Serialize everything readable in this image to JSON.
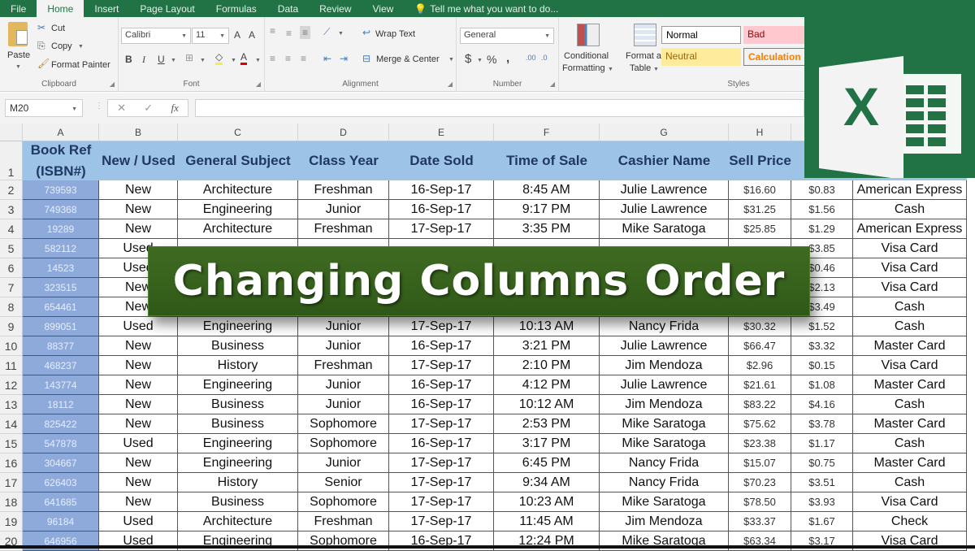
{
  "ribbon_tabs": [
    "File",
    "Home",
    "Insert",
    "Page Layout",
    "Formulas",
    "Data",
    "Review",
    "View"
  ],
  "tell_me": "Tell me what you want to do...",
  "clipboard": {
    "paste": "Paste",
    "cut": "Cut",
    "copy": "Copy",
    "format_painter": "Format Painter",
    "label": "Clipboard"
  },
  "font": {
    "name": "Calibri",
    "size": "11",
    "label": "Font",
    "bold": "B",
    "italic": "I",
    "underline": "U"
  },
  "alignment": {
    "wrap_text": "Wrap Text",
    "merge_center": "Merge & Center",
    "label": "Alignment"
  },
  "number": {
    "format": "General",
    "currency": "$",
    "percent": "%",
    "comma": ",",
    "label": "Number"
  },
  "styles": {
    "conditional": "Conditional",
    "formatting": "Formatting",
    "format_as": "Format as",
    "table": "Table",
    "normal": "Normal",
    "bad": "Bad",
    "neutral": "Neutral",
    "calculation": "Calculation",
    "label": "Styles"
  },
  "formula_bar": {
    "name_box": "M20",
    "value": ""
  },
  "banner": "Changing Columns Order",
  "logo_letter": "X",
  "columns": [
    "A",
    "B",
    "C",
    "D",
    "E",
    "F",
    "G",
    "H",
    "",
    ""
  ],
  "headers": [
    "Book Ref (ISBN#)",
    "New / Used",
    "General Subject",
    "Class Year",
    "Date Sold",
    "Time of Sale",
    "Cashier Name",
    "Sell Price",
    "",
    ""
  ],
  "rows": [
    [
      "739593",
      "New",
      "Architecture",
      "Freshman",
      "16-Sep-17",
      "8:45 AM",
      "Julie Lawrence",
      "$16.60",
      "$0.83",
      "American Express"
    ],
    [
      "749368",
      "New",
      "Engineering",
      "Junior",
      "16-Sep-17",
      "9:17 PM",
      "Julie Lawrence",
      "$31.25",
      "$1.56",
      "Cash"
    ],
    [
      "19289",
      "New",
      "Architecture",
      "Freshman",
      "17-Sep-17",
      "3:35 PM",
      "Mike Saratoga",
      "$25.85",
      "$1.29",
      "American Express"
    ],
    [
      "582112",
      "Used",
      "",
      "",
      "",
      "",
      "",
      "",
      "$3.85",
      "Visa Card"
    ],
    [
      "14523",
      "Used",
      "",
      "",
      "",
      "",
      "",
      "",
      "$0.46",
      "Visa Card"
    ],
    [
      "323515",
      "New",
      "",
      "",
      "",
      "",
      "",
      "",
      "$2.13",
      "Visa Card"
    ],
    [
      "654461",
      "New",
      "",
      "",
      "",
      "",
      "",
      "",
      "$3.49",
      "Cash"
    ],
    [
      "899051",
      "Used",
      "Engineering",
      "Junior",
      "17-Sep-17",
      "10:13 AM",
      "Nancy Frida",
      "$30.32",
      "$1.52",
      "Cash"
    ],
    [
      "88377",
      "New",
      "Business",
      "Junior",
      "16-Sep-17",
      "3:21 PM",
      "Julie Lawrence",
      "$66.47",
      "$3.32",
      "Master Card"
    ],
    [
      "468237",
      "New",
      "History",
      "Freshman",
      "17-Sep-17",
      "2:10 PM",
      "Jim Mendoza",
      "$2.96",
      "$0.15",
      "Visa Card"
    ],
    [
      "143774",
      "New",
      "Engineering",
      "Junior",
      "16-Sep-17",
      "4:12 PM",
      "Julie Lawrence",
      "$21.61",
      "$1.08",
      "Master Card"
    ],
    [
      "18112",
      "New",
      "Business",
      "Junior",
      "16-Sep-17",
      "10:12 AM",
      "Jim Mendoza",
      "$83.22",
      "$4.16",
      "Cash"
    ],
    [
      "825422",
      "New",
      "Business",
      "Sophomore",
      "17-Sep-17",
      "2:53 PM",
      "Mike Saratoga",
      "$75.62",
      "$3.78",
      "Master Card"
    ],
    [
      "547878",
      "Used",
      "Engineering",
      "Sophomore",
      "16-Sep-17",
      "3:17 PM",
      "Mike Saratoga",
      "$23.38",
      "$1.17",
      "Cash"
    ],
    [
      "304667",
      "New",
      "Engineering",
      "Junior",
      "17-Sep-17",
      "6:45 PM",
      "Nancy Frida",
      "$15.07",
      "$0.75",
      "Master Card"
    ],
    [
      "626403",
      "New",
      "History",
      "Senior",
      "17-Sep-17",
      "9:34 AM",
      "Nancy Frida",
      "$70.23",
      "$3.51",
      "Cash"
    ],
    [
      "641685",
      "New",
      "Business",
      "Sophomore",
      "17-Sep-17",
      "10:23 AM",
      "Mike Saratoga",
      "$78.50",
      "$3.93",
      "Visa Card"
    ],
    [
      "96184",
      "Used",
      "Architecture",
      "Freshman",
      "17-Sep-17",
      "11:45 AM",
      "Jim Mendoza",
      "$33.37",
      "$1.67",
      "Check"
    ],
    [
      "646956",
      "Used",
      "Engineering",
      "Sophomore",
      "16-Sep-17",
      "12:24 PM",
      "Mike Saratoga",
      "$63.34",
      "$3.17",
      "Visa Card"
    ]
  ]
}
